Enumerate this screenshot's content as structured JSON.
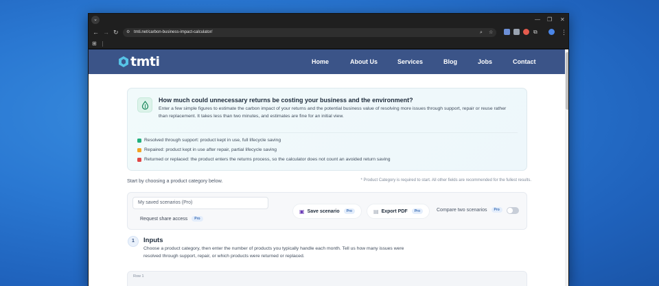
{
  "browser": {
    "url": "tmti.net/carbon-business-impact-calculator/"
  },
  "site": {
    "logo_text": "tmti",
    "nav": [
      "Home",
      "About Us",
      "Services",
      "Blog",
      "Jobs",
      "Contact"
    ]
  },
  "intro": {
    "title": "How much could unnecessary returns be costing your business and the environment?",
    "description": "Enter a few simple figures to estimate the carbon impact of your returns and the potential business value of resolving more issues through support, repair or reuse rather than replacement. It takes less than two minutes, and estimates are fine for an initial view.",
    "legend": [
      {
        "text": "Resolved through support: product kept in use, full lifecycle saving",
        "color": "#22b07d"
      },
      {
        "text": "Repaired: product kept in use after repair, partial lifecycle saving",
        "color": "#f2a324"
      },
      {
        "text": "Returned or replaced: the product enters the returns process, so the calculator does not count an avoided return saving",
        "color": "#e04848"
      }
    ]
  },
  "start_text": "Start by choosing a product category below.",
  "required_note": "* Product Category is required to start. All other fields are recommended for the fullest results.",
  "scenarios": {
    "saved_placeholder": "My saved scenarios (Pro)",
    "share_label": "Request share access",
    "save_label": "Save scenario",
    "export_label": "Export PDF",
    "compare_label": "Compare two scenarios",
    "pro_badge": "Pro",
    "compare_enabled": false
  },
  "inputs": {
    "step": "1",
    "title": "Inputs",
    "description": "Choose a product category, then enter the number of products you typically handle each month. Tell us how many issues were resolved through support, repair, or which products were returned or replaced.",
    "row_label": "Row 1"
  },
  "colors": {
    "nav_bg": "#3b5488",
    "accent": "#57c3e6"
  }
}
